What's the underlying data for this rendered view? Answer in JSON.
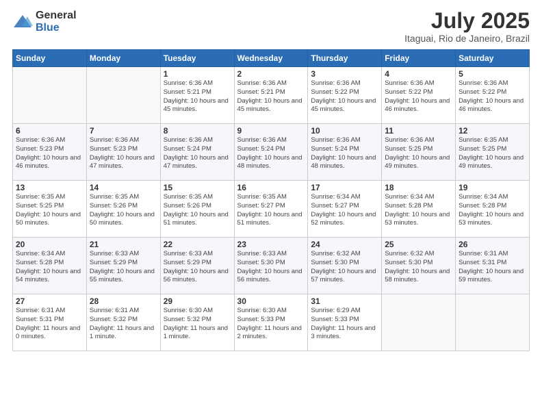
{
  "header": {
    "logo_general": "General",
    "logo_blue": "Blue",
    "title": "July 2025",
    "location": "Itaguai, Rio de Janeiro, Brazil"
  },
  "weekdays": [
    "Sunday",
    "Monday",
    "Tuesday",
    "Wednesday",
    "Thursday",
    "Friday",
    "Saturday"
  ],
  "weeks": [
    [
      {
        "day": "",
        "info": ""
      },
      {
        "day": "",
        "info": ""
      },
      {
        "day": "1",
        "info": "Sunrise: 6:36 AM\nSunset: 5:21 PM\nDaylight: 10 hours and 45 minutes."
      },
      {
        "day": "2",
        "info": "Sunrise: 6:36 AM\nSunset: 5:21 PM\nDaylight: 10 hours and 45 minutes."
      },
      {
        "day": "3",
        "info": "Sunrise: 6:36 AM\nSunset: 5:22 PM\nDaylight: 10 hours and 45 minutes."
      },
      {
        "day": "4",
        "info": "Sunrise: 6:36 AM\nSunset: 5:22 PM\nDaylight: 10 hours and 46 minutes."
      },
      {
        "day": "5",
        "info": "Sunrise: 6:36 AM\nSunset: 5:22 PM\nDaylight: 10 hours and 46 minutes."
      }
    ],
    [
      {
        "day": "6",
        "info": "Sunrise: 6:36 AM\nSunset: 5:23 PM\nDaylight: 10 hours and 46 minutes."
      },
      {
        "day": "7",
        "info": "Sunrise: 6:36 AM\nSunset: 5:23 PM\nDaylight: 10 hours and 47 minutes."
      },
      {
        "day": "8",
        "info": "Sunrise: 6:36 AM\nSunset: 5:24 PM\nDaylight: 10 hours and 47 minutes."
      },
      {
        "day": "9",
        "info": "Sunrise: 6:36 AM\nSunset: 5:24 PM\nDaylight: 10 hours and 48 minutes."
      },
      {
        "day": "10",
        "info": "Sunrise: 6:36 AM\nSunset: 5:24 PM\nDaylight: 10 hours and 48 minutes."
      },
      {
        "day": "11",
        "info": "Sunrise: 6:36 AM\nSunset: 5:25 PM\nDaylight: 10 hours and 49 minutes."
      },
      {
        "day": "12",
        "info": "Sunrise: 6:35 AM\nSunset: 5:25 PM\nDaylight: 10 hours and 49 minutes."
      }
    ],
    [
      {
        "day": "13",
        "info": "Sunrise: 6:35 AM\nSunset: 5:25 PM\nDaylight: 10 hours and 50 minutes."
      },
      {
        "day": "14",
        "info": "Sunrise: 6:35 AM\nSunset: 5:26 PM\nDaylight: 10 hours and 50 minutes."
      },
      {
        "day": "15",
        "info": "Sunrise: 6:35 AM\nSunset: 5:26 PM\nDaylight: 10 hours and 51 minutes."
      },
      {
        "day": "16",
        "info": "Sunrise: 6:35 AM\nSunset: 5:27 PM\nDaylight: 10 hours and 51 minutes."
      },
      {
        "day": "17",
        "info": "Sunrise: 6:34 AM\nSunset: 5:27 PM\nDaylight: 10 hours and 52 minutes."
      },
      {
        "day": "18",
        "info": "Sunrise: 6:34 AM\nSunset: 5:28 PM\nDaylight: 10 hours and 53 minutes."
      },
      {
        "day": "19",
        "info": "Sunrise: 6:34 AM\nSunset: 5:28 PM\nDaylight: 10 hours and 53 minutes."
      }
    ],
    [
      {
        "day": "20",
        "info": "Sunrise: 6:34 AM\nSunset: 5:28 PM\nDaylight: 10 hours and 54 minutes."
      },
      {
        "day": "21",
        "info": "Sunrise: 6:33 AM\nSunset: 5:29 PM\nDaylight: 10 hours and 55 minutes."
      },
      {
        "day": "22",
        "info": "Sunrise: 6:33 AM\nSunset: 5:29 PM\nDaylight: 10 hours and 56 minutes."
      },
      {
        "day": "23",
        "info": "Sunrise: 6:33 AM\nSunset: 5:30 PM\nDaylight: 10 hours and 56 minutes."
      },
      {
        "day": "24",
        "info": "Sunrise: 6:32 AM\nSunset: 5:30 PM\nDaylight: 10 hours and 57 minutes."
      },
      {
        "day": "25",
        "info": "Sunrise: 6:32 AM\nSunset: 5:30 PM\nDaylight: 10 hours and 58 minutes."
      },
      {
        "day": "26",
        "info": "Sunrise: 6:31 AM\nSunset: 5:31 PM\nDaylight: 10 hours and 59 minutes."
      }
    ],
    [
      {
        "day": "27",
        "info": "Sunrise: 6:31 AM\nSunset: 5:31 PM\nDaylight: 11 hours and 0 minutes."
      },
      {
        "day": "28",
        "info": "Sunrise: 6:31 AM\nSunset: 5:32 PM\nDaylight: 11 hours and 1 minute."
      },
      {
        "day": "29",
        "info": "Sunrise: 6:30 AM\nSunset: 5:32 PM\nDaylight: 11 hours and 1 minute."
      },
      {
        "day": "30",
        "info": "Sunrise: 6:30 AM\nSunset: 5:33 PM\nDaylight: 11 hours and 2 minutes."
      },
      {
        "day": "31",
        "info": "Sunrise: 6:29 AM\nSunset: 5:33 PM\nDaylight: 11 hours and 3 minutes."
      },
      {
        "day": "",
        "info": ""
      },
      {
        "day": "",
        "info": ""
      }
    ]
  ]
}
